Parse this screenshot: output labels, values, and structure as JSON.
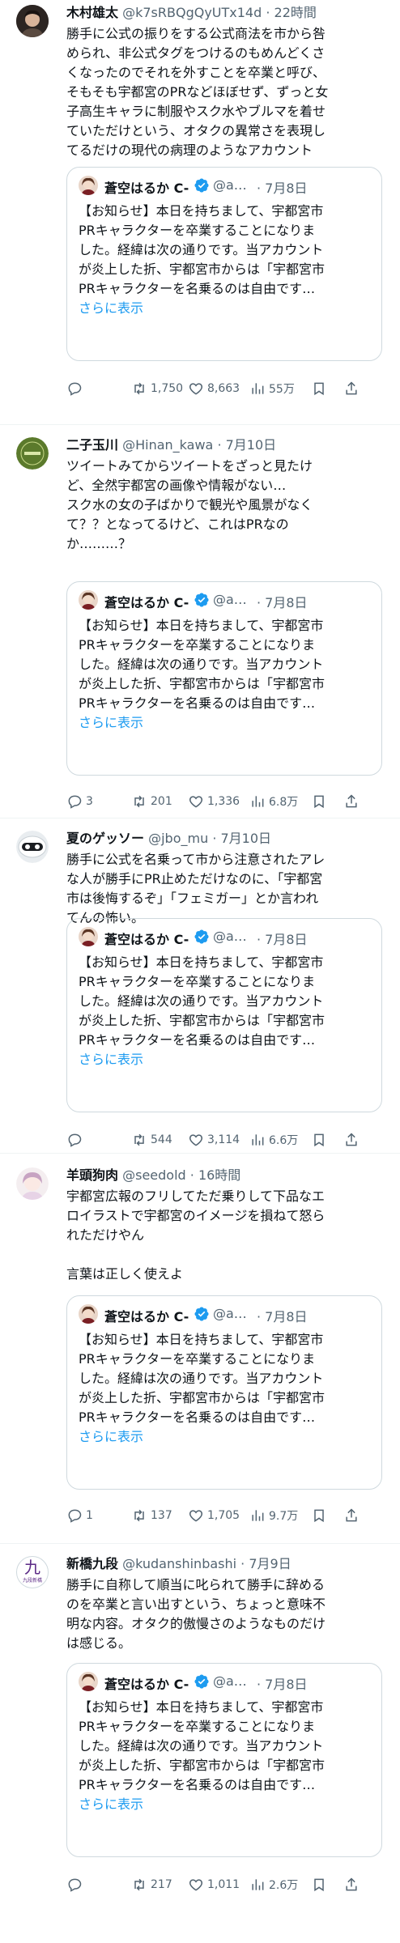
{
  "quote": {
    "name": "蒼空はるか C-1…",
    "handle": "@a…",
    "date": "· 7月8日",
    "lines": [
      "【お知らせ】本日を持ちまして、宇都宮市",
      "PRキャラクターを卒業することになりま",
      "した。経緯は次の通りです。当アカウント",
      "が炎上した折、宇都宮市からは「宇都宮市",
      "PRキャラクターを名乗るのは自由です…"
    ],
    "show_more": "さらに表示"
  },
  "tweets": [
    {
      "name": "木村雄太",
      "meta": "@k7sRBQgQyUTx14d · 22時間",
      "lines": [
        "勝手に公式の振りをする公式商法を市から咎",
        "められ、非公式タグをつけるのもめんどくさ",
        "くなったのでそれを外すことを卒業と呼び、",
        "そもそも宇都宮のPRなどほぼせず、ずっと女",
        "子高生キャラに制服やスク水やブルマを着せ",
        "ていただけという、オタクの異常さを表現し",
        "てるだけの現代の病理のようなアカウント"
      ],
      "reply": "",
      "retweet": "1,750",
      "like": "8,663",
      "views": "55万"
    },
    {
      "name": "二子玉川",
      "meta": "@Hinan_kawa · 7月10日",
      "lines": [
        "ツイートみてからツイートをざっと見たけ",
        "ど、全然宇都宮の画像や情報がない…",
        "スク水の女の子ばかりで観光や風景がなく",
        "て？？となってるけど、これはPRなの",
        "か………？"
      ],
      "reply": "3",
      "retweet": "201",
      "like": "1,336",
      "views": "6.8万"
    },
    {
      "name": "夏のゲッソー",
      "meta": "@jbo_mu · 7月10日",
      "lines": [
        "勝手に公式を名乗って市から注意されたアレ",
        "な人が勝手にPR止めただけなのに、「宇都宮",
        "市は後悔するぞ」「フェミガー」とか言われ",
        "てんの怖い。"
      ],
      "reply": "",
      "retweet": "544",
      "like": "3,114",
      "views": "6.6万"
    },
    {
      "name": "羊頭狗肉",
      "meta": "@seedold · 16時間",
      "lines": [
        "宇都宮広報のフリしてただ乗りして下品なエ",
        "ロイラストで宇都宮のイメージを損ねて怒ら",
        "れただけやん",
        "",
        "言葉は正しく使えよ"
      ],
      "reply": "1",
      "retweet": "137",
      "like": "1,705",
      "views": "9.7万"
    },
    {
      "name": "新橋九段",
      "meta": "@kudanshinbashi · 7月9日",
      "lines": [
        "勝手に自称して順当に叱られて勝手に辞める",
        "のを卒業と言い出すという、ちょっと意味不",
        "明な内容。オタク的傲慢さのようなものだけ",
        "は感じる。"
      ],
      "reply": "",
      "retweet": "217",
      "like": "1,011",
      "views": "2.6万"
    }
  ],
  "avatars": {
    "t1": "photo-avatar",
    "t2": "green-logo-avatar",
    "t3": "robot-avatar",
    "t4": "anime-avatar",
    "t5": "kanji-avatar",
    "t5_char": "九",
    "t5_sub": "九段新橋"
  },
  "colors": {
    "accent": "#1d9bf0",
    "muted": "#536471",
    "text": "#0f1419",
    "border": "#cfd9de"
  }
}
